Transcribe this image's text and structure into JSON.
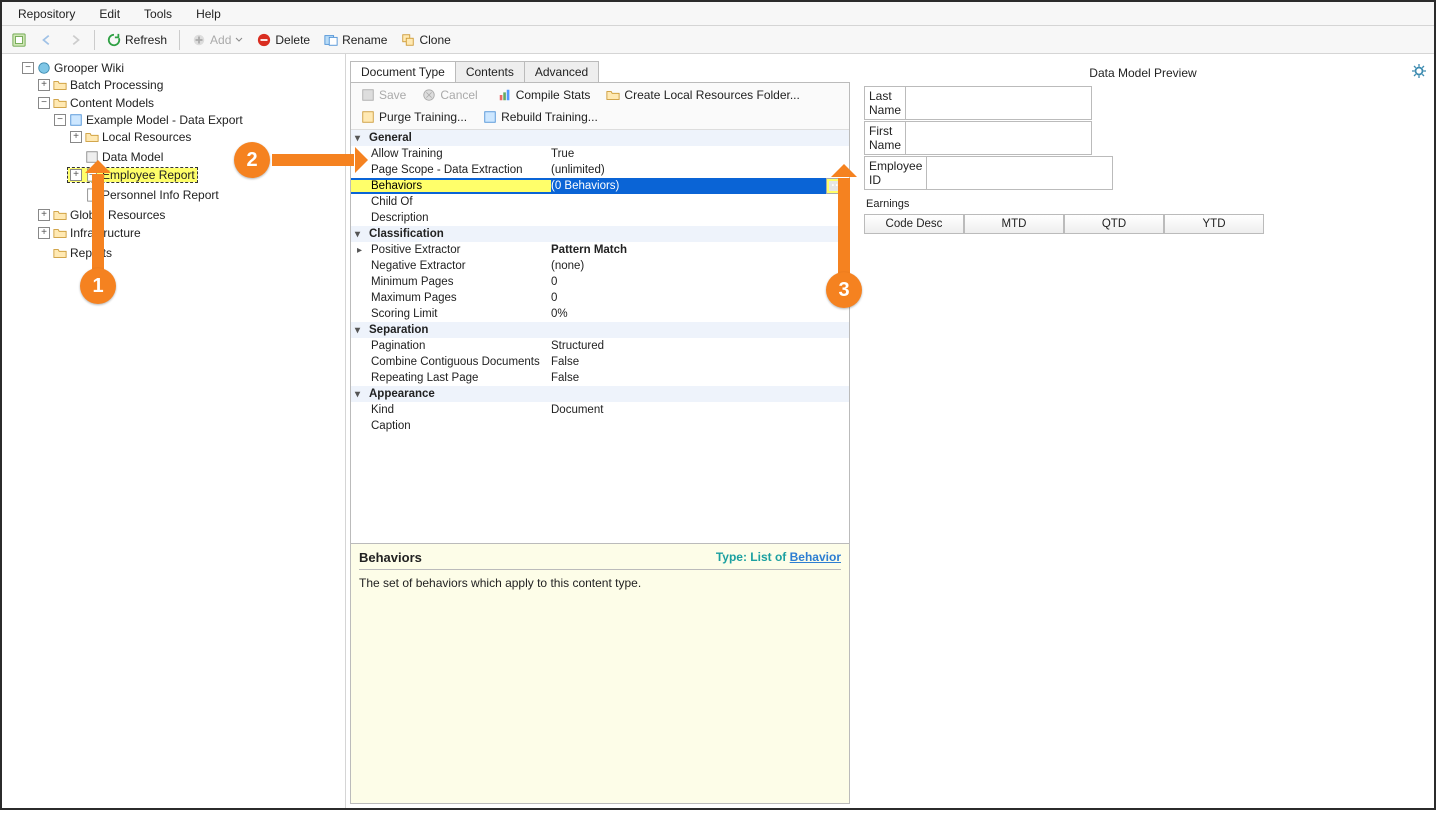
{
  "menu": {
    "repository": "Repository",
    "edit": "Edit",
    "tools": "Tools",
    "help": "Help"
  },
  "toolbar": {
    "refresh": "Refresh",
    "add": "Add",
    "delete": "Delete",
    "rename": "Rename",
    "clone": "Clone"
  },
  "tree": {
    "root": "Grooper Wiki",
    "batch": "Batch Processing",
    "content": "Content Models",
    "example": "Example Model - Data Export",
    "local": "Local Resources",
    "datamodel": "Data Model",
    "employee": "Employee Report",
    "personnel": "Personnel Info Report",
    "global": "Global Resources",
    "infra": "Infrastructure",
    "reports": "Reports"
  },
  "tabs": {
    "doctype": "Document Type",
    "contents": "Contents",
    "advanced": "Advanced"
  },
  "innerbar": {
    "save": "Save",
    "cancel": "Cancel",
    "compile": "Compile Stats",
    "createlocal": "Create Local Resources Folder...",
    "purge": "Purge Training...",
    "rebuild": "Rebuild Training..."
  },
  "props": {
    "cat_general": "General",
    "allow_training": {
      "k": "Allow Training",
      "v": "True"
    },
    "page_scope": {
      "k": "Page Scope - Data Extraction",
      "v": "(unlimited)"
    },
    "behaviors": {
      "k": "Behaviors",
      "v": "(0 Behaviors)"
    },
    "childof": {
      "k": "Child Of",
      "v": ""
    },
    "description": {
      "k": "Description",
      "v": ""
    },
    "cat_class": "Classification",
    "pos_ex": {
      "k": "Positive Extractor",
      "v": "Pattern Match"
    },
    "neg_ex": {
      "k": "Negative Extractor",
      "v": "(none)"
    },
    "minpages": {
      "k": "Minimum Pages",
      "v": "0"
    },
    "maxpages": {
      "k": "Maximum Pages",
      "v": "0"
    },
    "scoring": {
      "k": "Scoring Limit",
      "v": "0%"
    },
    "cat_sep": "Separation",
    "pagination": {
      "k": "Pagination",
      "v": "Structured"
    },
    "combine": {
      "k": "Combine Contiguous Documents",
      "v": "False"
    },
    "repeat": {
      "k": "Repeating Last Page",
      "v": "False"
    },
    "cat_app": "Appearance",
    "kind": {
      "k": "Kind",
      "v": "Document"
    },
    "caption": {
      "k": "Caption",
      "v": ""
    }
  },
  "desc": {
    "title": "Behaviors",
    "type_prefix": "Type: List of ",
    "type_link": "Behavior",
    "body": "The set of behaviors which apply to this content type."
  },
  "preview": {
    "heading": "Data Model Preview",
    "lastname": "Last Name",
    "firstname": "First Name",
    "empid": "Employee ID",
    "earnings": "Earnings",
    "cols": {
      "code": "Code Desc",
      "mtd": "MTD",
      "qtd": "QTD",
      "ytd": "YTD"
    }
  },
  "annotations": {
    "b1": "1",
    "b2": "2",
    "b3": "3"
  },
  "ellipsis": "···"
}
